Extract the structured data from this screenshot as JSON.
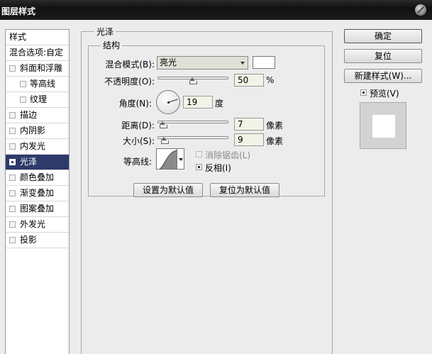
{
  "window": {
    "title": "图层样式"
  },
  "style_list": {
    "items": [
      {
        "label": "样式",
        "type": "header"
      },
      {
        "label": "混合选项:自定",
        "type": "header"
      },
      {
        "label": "斜面和浮雕",
        "checked": false
      },
      {
        "label": "等高线",
        "checked": false,
        "indent": true
      },
      {
        "label": "纹理",
        "checked": false,
        "indent": true
      },
      {
        "label": "描边",
        "checked": false
      },
      {
        "label": "内阴影",
        "checked": false
      },
      {
        "label": "内发光",
        "checked": false
      },
      {
        "label": "光泽",
        "checked": true,
        "selected": true
      },
      {
        "label": "颜色叠加",
        "checked": false
      },
      {
        "label": "渐变叠加",
        "checked": false
      },
      {
        "label": "图案叠加",
        "checked": false
      },
      {
        "label": "外发光",
        "checked": false
      },
      {
        "label": "投影",
        "checked": false
      }
    ]
  },
  "satin": {
    "group_title": "光泽",
    "structure_title": "结构",
    "blend_mode": {
      "label": "混合模式(B):",
      "value": "亮光"
    },
    "opacity": {
      "label": "不透明度(O):",
      "value": "50",
      "unit": "%"
    },
    "angle": {
      "label": "角度(N):",
      "value": "19",
      "unit": "度"
    },
    "distance": {
      "label": "距离(D):",
      "value": "7",
      "unit": "像素"
    },
    "size": {
      "label": "大小(S):",
      "value": "9",
      "unit": "像素"
    },
    "contour": {
      "label": "等高线:"
    },
    "anti_alias": {
      "label": "消除锯齿(L)",
      "checked": false,
      "disabled": true
    },
    "invert": {
      "label": "反相(I)",
      "checked": true
    },
    "make_default_label": "设置为默认值",
    "reset_default_label": "复位为默认值"
  },
  "buttons": {
    "ok": "确定",
    "reset": "复位",
    "new_style": "新建样式(W)..."
  },
  "preview": {
    "label": "预览(V)",
    "checked": true
  },
  "colors": {
    "selected_bg": "#2d3a6b",
    "field_bg": "#f2f2e6"
  }
}
